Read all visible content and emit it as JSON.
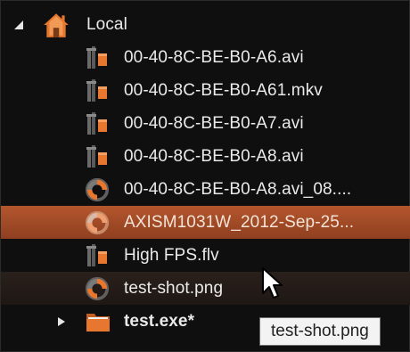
{
  "tree": {
    "root": {
      "label": "Local",
      "icon": "home-icon",
      "expanded": true
    },
    "items": [
      {
        "label": "00-40-8C-BE-B0-A6.avi",
        "icon": "film-icon",
        "state": "normal"
      },
      {
        "label": "00-40-8C-BE-B0-A61.mkv",
        "icon": "film-icon",
        "state": "normal"
      },
      {
        "label": "00-40-8C-BE-B0-A7.avi",
        "icon": "film-icon",
        "state": "normal"
      },
      {
        "label": "00-40-8C-BE-B0-A8.avi",
        "icon": "film-icon",
        "state": "normal"
      },
      {
        "label": "00-40-8C-BE-B0-A8.avi_08....",
        "icon": "aperture-icon",
        "state": "normal"
      },
      {
        "label": "AXISM1031W_2012-Sep-25...",
        "icon": "aperture-icon",
        "state": "selected"
      },
      {
        "label": "High FPS.flv",
        "icon": "film-icon",
        "state": "normal"
      },
      {
        "label": "test-shot.png",
        "icon": "aperture-icon",
        "state": "hover"
      },
      {
        "label": "test.exe*",
        "icon": "folder-icon",
        "state": "normal",
        "bold": true,
        "collapsed": true
      }
    ]
  },
  "tooltip": {
    "text": "test-shot.png"
  },
  "colors": {
    "background": "#0f0f0f",
    "selection": "#a44c28",
    "hover": "#231b17",
    "accent_orange": "#e7772e",
    "icon_gray": "#6a6a6a"
  }
}
